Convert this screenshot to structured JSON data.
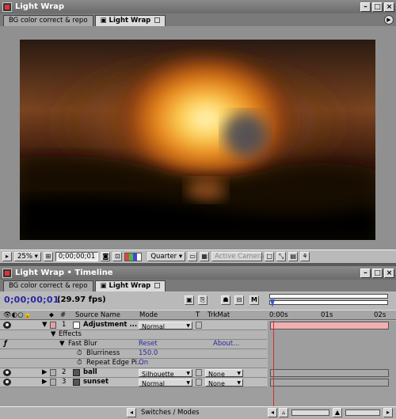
{
  "comp_window": {
    "title": "Light Wrap",
    "tabs": [
      {
        "label": "BG color correct & repo",
        "active": false
      },
      {
        "label": "Light Wrap",
        "active": true
      }
    ],
    "toolbar": {
      "zoom": "25%",
      "timecode": "0;00;00;01",
      "resolution": "Quarter",
      "camera": "Active Camera"
    }
  },
  "timeline": {
    "title": "Light Wrap • Timeline",
    "tabs": [
      {
        "label": "BG color correct & repo",
        "active": false
      },
      {
        "label": "Light Wrap",
        "active": true
      }
    ],
    "current_time": "0;00;00;01",
    "fps": "(29.97 fps)",
    "buttons": {
      "motion_blur": "M"
    },
    "columns": {
      "number": "#",
      "source_name": "Source Name",
      "mode": "Mode",
      "t": "T",
      "trkmat": "TrkMat"
    },
    "ruler": {
      "labels": [
        "0:00s",
        "01s",
        "02s"
      ]
    },
    "layers": [
      {
        "number": "1",
        "name": "Adjustment ...",
        "mode": "Normal",
        "trkmat": "",
        "color": "#e6a0a0",
        "bar_color": "#f0b0b0"
      },
      {
        "number": "2",
        "name": "ball",
        "mode": "Silhouette Alpha",
        "trkmat": "None",
        "color": "#b0b0b0",
        "bar_color": "#9e9e9e"
      },
      {
        "number": "3",
        "name": "sunset",
        "mode": "Normal",
        "trkmat": "None",
        "color": "#b0b0b0",
        "bar_color": "#9e9e9e"
      }
    ],
    "effects": {
      "group_label": "Effects",
      "effect_name": "Fast Blur",
      "reset_label": "Reset",
      "about_label": "About...",
      "params": [
        {
          "name": "Blurriness",
          "value": "150.0"
        },
        {
          "name": "Repeat Edge Pi...",
          "value": "On"
        }
      ]
    },
    "footer": {
      "switches_label": "Switches / Modes"
    }
  },
  "colors": {
    "timecode_blue": "#2727a8",
    "link_blue": "#2a2aa0",
    "playhead": "#d03030"
  }
}
